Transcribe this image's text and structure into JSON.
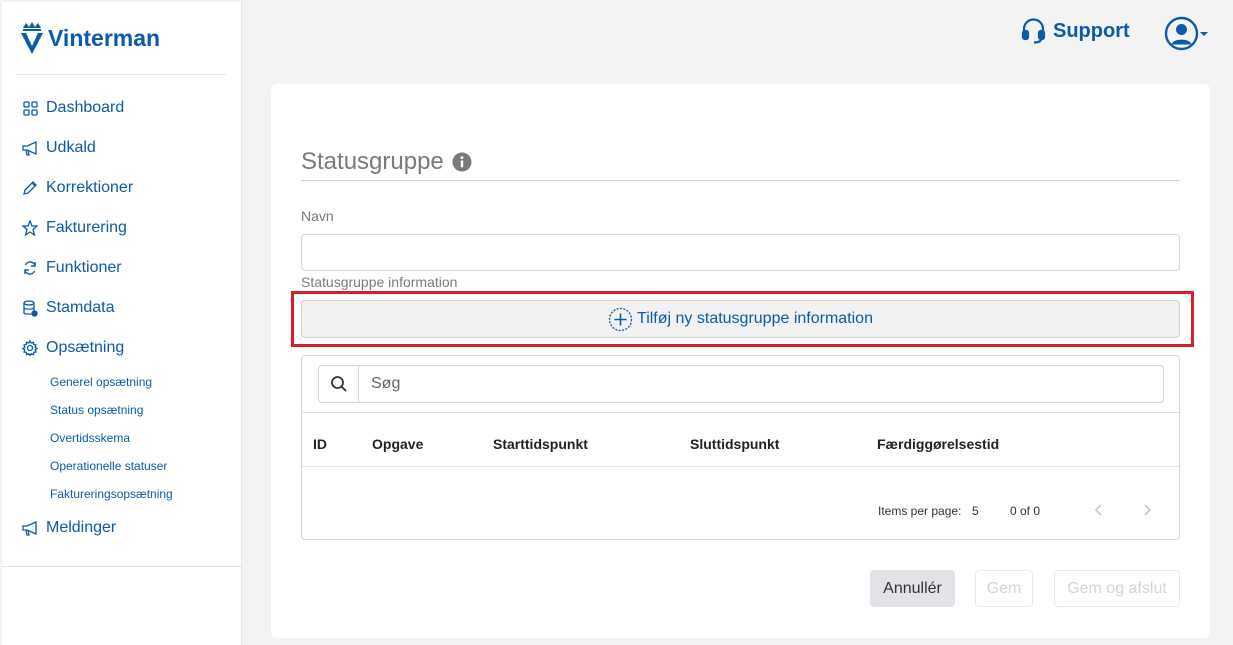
{
  "brand": {
    "name": "Vinterman",
    "color": "#0d5aa7"
  },
  "sidebar": {
    "items": [
      {
        "label": "Dashboard",
        "icon": "grid-icon"
      },
      {
        "label": "Udkald",
        "icon": "megaphone-icon"
      },
      {
        "label": "Korrektioner",
        "icon": "pencil-icon"
      },
      {
        "label": "Fakturering",
        "icon": "star-icon"
      },
      {
        "label": "Funktioner",
        "icon": "refresh-icon"
      },
      {
        "label": "Stamdata",
        "icon": "database-icon"
      },
      {
        "label": "Opsætning",
        "icon": "gear-icon"
      }
    ],
    "subitems": [
      {
        "label": "Generel opsætning"
      },
      {
        "label": "Status opsætning"
      },
      {
        "label": "Overtidsskema"
      },
      {
        "label": "Operationelle statuser"
      },
      {
        "label": "Faktureringsopsætning"
      }
    ],
    "last_item": {
      "label": "Meldinger",
      "icon": "megaphone-icon"
    }
  },
  "header": {
    "support_label": "Support",
    "support_icon": "headset-icon",
    "user_icon": "user-circle-icon"
  },
  "form": {
    "title": "Statusgruppe",
    "name_label": "Navn",
    "name_value": "",
    "info_label": "Statusgruppe information",
    "add_button_label": "Tilføj ny statusgruppe information",
    "highlight_color": "#d61f26"
  },
  "table": {
    "search_placeholder": "Søg",
    "columns": [
      "ID",
      "Opgave",
      "Starttidspunkt",
      "Sluttidspunkt",
      "Færdiggørelsestid"
    ],
    "rows": [],
    "items_per_page_label": "Items per page:",
    "items_per_page_value": "5",
    "range_label": "0 of 0"
  },
  "actions": {
    "cancel_label": "Annullér",
    "save_label": "Gem",
    "save_close_label": "Gem og afslut"
  }
}
